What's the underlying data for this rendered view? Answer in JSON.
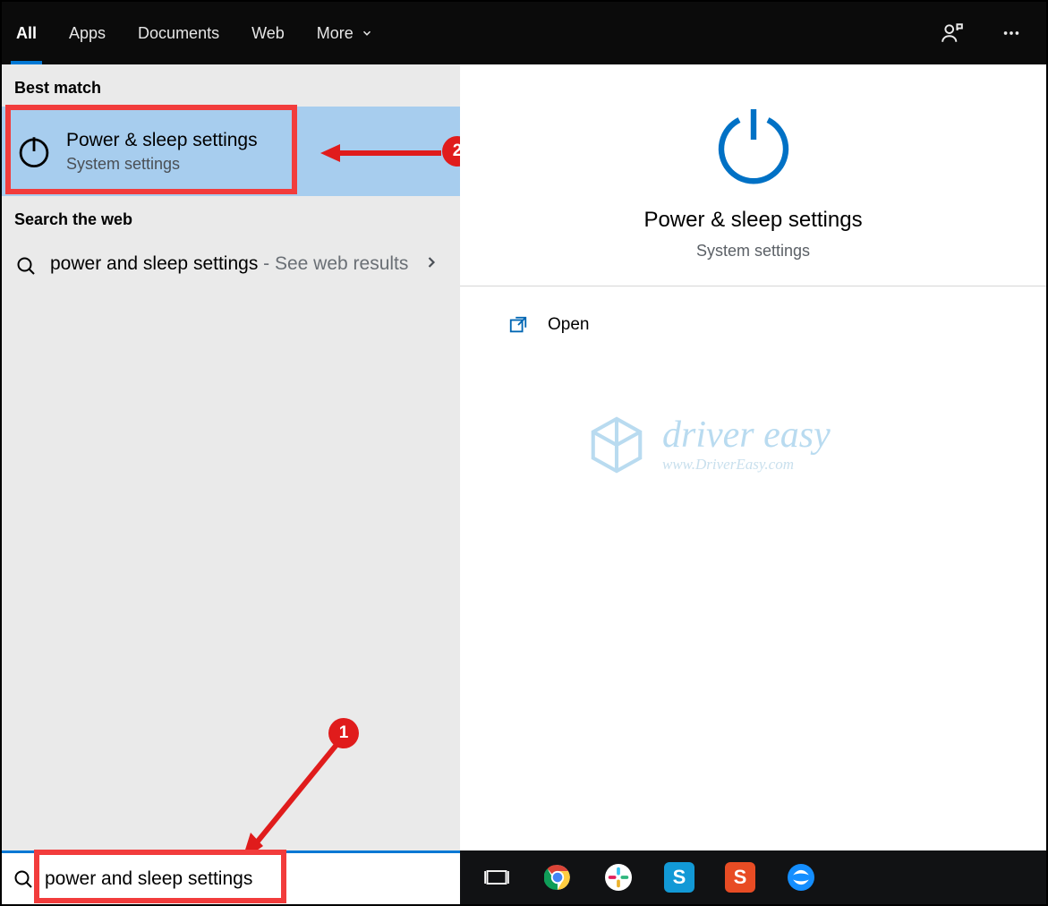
{
  "topbar": {
    "tabs": [
      "All",
      "Apps",
      "Documents",
      "Web",
      "More"
    ]
  },
  "left": {
    "best_match_header": "Best match",
    "best_match": {
      "title": "Power & sleep settings",
      "subtitle": "System settings"
    },
    "web_header": "Search the web",
    "web_result": {
      "query": "power and sleep settings",
      "suffix": " - See web results"
    }
  },
  "right": {
    "title": "Power & sleep settings",
    "subtitle": "System settings",
    "action_open": "Open"
  },
  "watermark": {
    "line1": "driver easy",
    "line2": "www.DriverEasy.com"
  },
  "callouts": {
    "badge1": "1",
    "badge2": "2"
  },
  "search": {
    "value": "power and sleep settings"
  }
}
